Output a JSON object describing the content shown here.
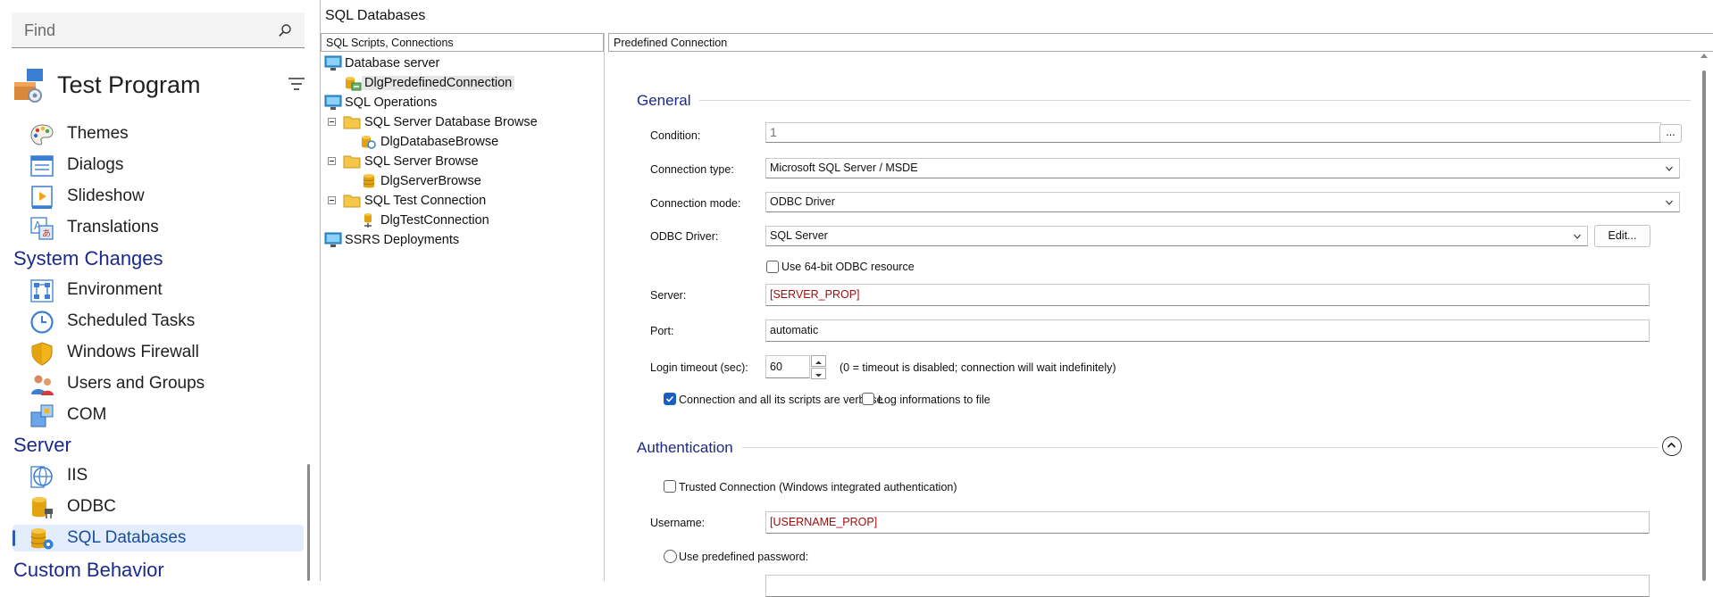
{
  "search": {
    "placeholder": "Find"
  },
  "app": {
    "title": "Test Program"
  },
  "nav": {
    "items_top": [
      {
        "label": "Themes",
        "icon": "themes-icon"
      },
      {
        "label": "Dialogs",
        "icon": "dialogs-icon"
      },
      {
        "label": "Slideshow",
        "icon": "slideshow-icon"
      },
      {
        "label": "Translations",
        "icon": "translations-icon"
      }
    ],
    "section_system": "System Changes",
    "items_system": [
      {
        "label": "Environment",
        "icon": "environment-icon"
      },
      {
        "label": "Scheduled Tasks",
        "icon": "clock-icon"
      },
      {
        "label": "Windows Firewall",
        "icon": "shield-icon"
      },
      {
        "label": "Users and Groups",
        "icon": "users-icon"
      },
      {
        "label": "COM",
        "icon": "com-icon"
      }
    ],
    "section_server": "Server",
    "items_server": [
      {
        "label": "IIS",
        "icon": "iis-icon"
      },
      {
        "label": "ODBC",
        "icon": "odbc-icon"
      },
      {
        "label": "SQL Databases",
        "icon": "sql-databases-icon",
        "selected": true
      }
    ],
    "section_custom": "Custom Behavior"
  },
  "main": {
    "title": "SQL Databases",
    "tree_header": "SQL Scripts, Connections",
    "props_header": "Predefined Connection",
    "tree": [
      {
        "label": "Database server"
      },
      {
        "label": "DlgPredefinedConnection",
        "selected": true
      },
      {
        "label": "SQL Operations"
      },
      {
        "label": "SQL Server Database Browse"
      },
      {
        "label": "DlgDatabaseBrowse"
      },
      {
        "label": "SQL Server Browse"
      },
      {
        "label": "DlgServerBrowse"
      },
      {
        "label": "SQL Test Connection"
      },
      {
        "label": "DlgTestConnection"
      },
      {
        "label": "SSRS Deployments"
      }
    ]
  },
  "general": {
    "title": "General",
    "condition_label": "Condition:",
    "condition_value": "1",
    "condition_button": "...",
    "conn_type_label": "Connection type:",
    "conn_type_value": "Microsoft SQL Server / MSDE",
    "conn_mode_label": "Connection mode:",
    "conn_mode_value": "ODBC Driver",
    "odbc_driver_label": "ODBC Driver:",
    "odbc_driver_value": "SQL Server",
    "edit_button": "Edit...",
    "use64_label": "Use 64-bit ODBC resource",
    "use64_checked": false,
    "server_label": "Server:",
    "server_value": "[SERVER_PROP]",
    "port_label": "Port:",
    "port_value": "automatic",
    "login_timeout_label": "Login timeout (sec):",
    "login_timeout_value": "60",
    "login_timeout_note": "(0 = timeout is disabled; connection will wait indefinitely)",
    "verbose_label": "Connection and all its scripts are verbose",
    "verbose_checked": true,
    "log_label": "Log informations to file",
    "log_checked": false
  },
  "auth": {
    "title": "Authentication",
    "trusted_label": "Trusted Connection (Windows integrated authentication)",
    "trusted_checked": false,
    "username_label": "Username:",
    "username_value": "[USERNAME_PROP]",
    "predefined_pwd_label": "Use predefined password:"
  },
  "colors": {
    "accent": "#1b2a8a",
    "selection": "#e3edfb",
    "check": "#1a5fc0",
    "property_red": "#a10d0d"
  }
}
